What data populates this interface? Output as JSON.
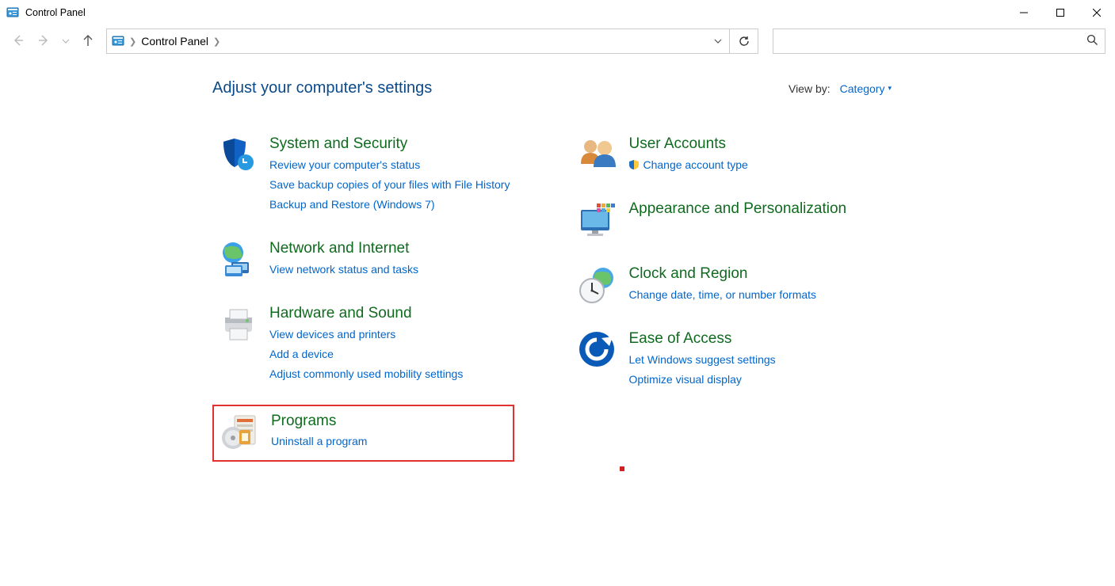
{
  "window": {
    "title": "Control Panel"
  },
  "breadcrumb": {
    "root": "Control Panel"
  },
  "search": {
    "placeholder": ""
  },
  "header": {
    "heading": "Adjust your computer's settings",
    "viewby_label": "View by:",
    "viewby_value": "Category"
  },
  "left": [
    {
      "title": "System and Security",
      "links": [
        "Review your computer's status",
        "Save backup copies of your files with File History",
        "Backup and Restore (Windows 7)"
      ]
    },
    {
      "title": "Network and Internet",
      "links": [
        "View network status and tasks"
      ]
    },
    {
      "title": "Hardware and Sound",
      "links": [
        "View devices and printers",
        "Add a device",
        "Adjust commonly used mobility settings"
      ]
    },
    {
      "title": "Programs",
      "links": [
        "Uninstall a program"
      ]
    }
  ],
  "right": [
    {
      "title": "User Accounts",
      "links": [
        "Change account type"
      ],
      "shield_on": [
        0
      ]
    },
    {
      "title": "Appearance and Personalization",
      "links": []
    },
    {
      "title": "Clock and Region",
      "links": [
        "Change date, time, or number formats"
      ]
    },
    {
      "title": "Ease of Access",
      "links": [
        "Let Windows suggest settings",
        "Optimize visual display"
      ]
    }
  ]
}
